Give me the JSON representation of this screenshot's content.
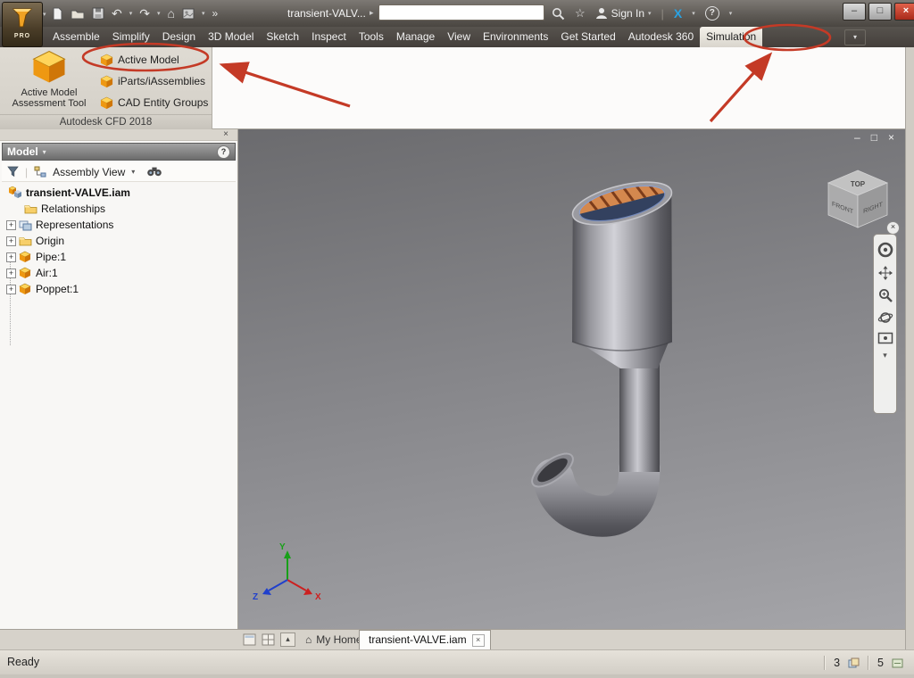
{
  "titlebar": {
    "title": "transient-VALV...",
    "pro_label": "PRO",
    "signin_label": "Sign In"
  },
  "ribbon": {
    "tabs": [
      "Assemble",
      "Simplify",
      "Design",
      "3D Model",
      "Sketch",
      "Inspect",
      "Tools",
      "Manage",
      "View",
      "Environments",
      "Get Started",
      "Autodesk 360",
      "Simulation"
    ],
    "active_tab": "Simulation",
    "panel": {
      "big_button": {
        "line1": "Active Model",
        "line2": "Assessment Tool"
      },
      "items": [
        "Active Model",
        "iParts/iAssemblies",
        "CAD Entity Groups"
      ],
      "footer": "Autodesk CFD 2018"
    }
  },
  "browser": {
    "header_label": "Model",
    "view_selector": "Assembly View",
    "tree": [
      {
        "label": "transient-VALVE.iam",
        "icon": "assembly-icon"
      },
      {
        "label": "Relationships",
        "icon": "folder-icon"
      },
      {
        "label": "Representations",
        "icon": "representations-icon"
      },
      {
        "label": "Origin",
        "icon": "folder-icon"
      },
      {
        "label": "Pipe:1",
        "icon": "part-icon"
      },
      {
        "label": "Air:1",
        "icon": "part-icon"
      },
      {
        "label": "Poppet:1",
        "icon": "part-icon"
      }
    ]
  },
  "viewport": {
    "viewcube": {
      "top": "TOP",
      "front": "FRONT",
      "right": "RIGHT"
    },
    "triad": {
      "x": "X",
      "y": "Y",
      "z": "Z"
    }
  },
  "doc_tabs": {
    "home_label": "My Home",
    "active_label": "transient-VALVE.iam"
  },
  "statusbar": {
    "ready_label": "Ready",
    "value1": "3",
    "value2": "5"
  },
  "icons": {
    "dropdown": "▾",
    "caret_right": "▸",
    "overflow": "»",
    "home": "⌂",
    "undo": "↶",
    "redo": "↷",
    "star": "☆",
    "help": "?",
    "a360_x": "X",
    "minimize": "–",
    "maximize": "□",
    "close": "×",
    "up": "▴",
    "plus": "+"
  },
  "colors": {
    "annotation_red": "#c43a26",
    "accent_orange": "#e8961e"
  }
}
